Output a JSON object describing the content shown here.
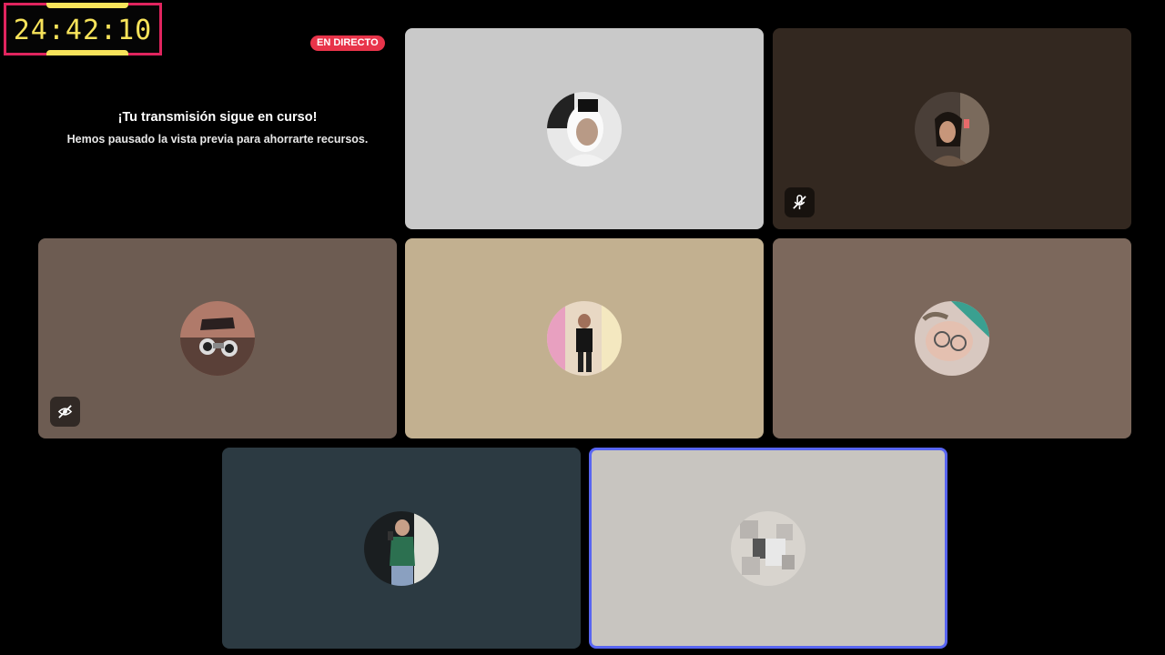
{
  "timer": {
    "time": "24:42:10"
  },
  "live_badge": {
    "label": "EN DIRECTO"
  },
  "stream_notice": {
    "title": "¡Tu transmisión sigue en curso!",
    "subtitle": "Hemos pausado la vista previa para ahorrarte recursos."
  },
  "tiles": [
    {
      "bg": "#c9c9c9",
      "status": "none",
      "speaking": false
    },
    {
      "bg": "#332820",
      "status": "muted",
      "speaking": false
    },
    {
      "bg": "#6d5c52",
      "status": "video-off",
      "speaking": false
    },
    {
      "bg": "#c2b090",
      "status": "none",
      "speaking": false
    },
    {
      "bg": "#7c685c",
      "status": "none",
      "speaking": false
    },
    {
      "bg": "#2c3a42",
      "status": "none",
      "speaking": false
    },
    {
      "bg": "#c8c5c0",
      "status": "none",
      "speaking": true
    }
  ],
  "colors": {
    "timer_border": "#e0245e",
    "timer_text": "#f7e35a",
    "live_badge": "#e8344a",
    "speaking_ring": "#5865f2"
  }
}
